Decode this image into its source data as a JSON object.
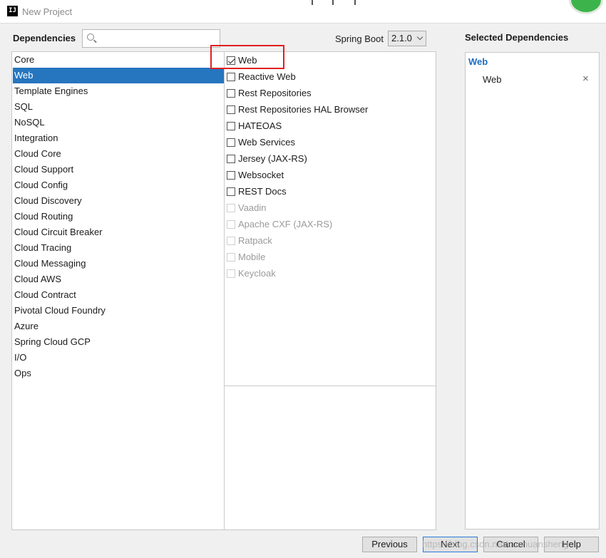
{
  "window": {
    "title": "New Project",
    "app_icon_text": "IJ"
  },
  "dependencies": {
    "label": "Dependencies",
    "search": {
      "value": "",
      "placeholder": ""
    }
  },
  "spring_boot": {
    "label": "Spring Boot",
    "selected": "2.1.0"
  },
  "categories": [
    "Core",
    "Web",
    "Template Engines",
    "SQL",
    "NoSQL",
    "Integration",
    "Cloud Core",
    "Cloud Support",
    "Cloud Config",
    "Cloud Discovery",
    "Cloud Routing",
    "Cloud Circuit Breaker",
    "Cloud Tracing",
    "Cloud Messaging",
    "Cloud AWS",
    "Cloud Contract",
    "Pivotal Cloud Foundry",
    "Azure",
    "Spring Cloud GCP",
    "I/O",
    "Ops"
  ],
  "selected_category": "Web",
  "web_dependencies": [
    {
      "label": "Web",
      "checked": true,
      "enabled": true
    },
    {
      "label": "Reactive Web",
      "checked": false,
      "enabled": true
    },
    {
      "label": "Rest Repositories",
      "checked": false,
      "enabled": true
    },
    {
      "label": "Rest Repositories HAL Browser",
      "checked": false,
      "enabled": true
    },
    {
      "label": "HATEOAS",
      "checked": false,
      "enabled": true
    },
    {
      "label": "Web Services",
      "checked": false,
      "enabled": true
    },
    {
      "label": "Jersey (JAX-RS)",
      "checked": false,
      "enabled": true
    },
    {
      "label": "Websocket",
      "checked": false,
      "enabled": true
    },
    {
      "label": "REST Docs",
      "checked": false,
      "enabled": true
    },
    {
      "label": "Vaadin",
      "checked": false,
      "enabled": false
    },
    {
      "label": "Apache CXF (JAX-RS)",
      "checked": false,
      "enabled": false
    },
    {
      "label": "Ratpack",
      "checked": false,
      "enabled": false
    },
    {
      "label": "Mobile",
      "checked": false,
      "enabled": false
    },
    {
      "label": "Keycloak",
      "checked": false,
      "enabled": false
    }
  ],
  "selected_dependencies": {
    "label": "Selected Dependencies",
    "group": "Web",
    "items": [
      {
        "label": "Web",
        "remove_icon": "×"
      }
    ]
  },
  "buttons": {
    "previous": "Previous",
    "next": "Next",
    "cancel": "Cancel",
    "help": "Help"
  },
  "watermark": "https://blog.csdn.net/sunhuansheng",
  "colors": {
    "selection": "#2675bf",
    "highlight_box": "#e02020",
    "group_title": "#1e6dc2"
  }
}
